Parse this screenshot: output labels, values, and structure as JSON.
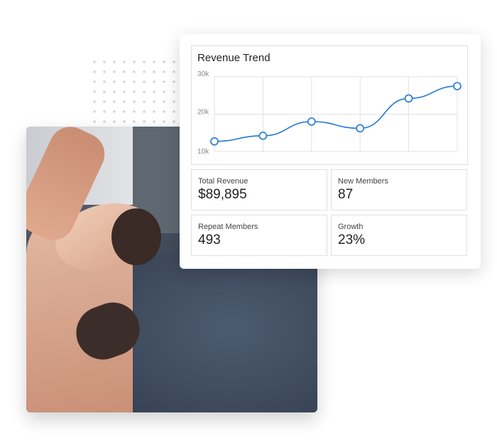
{
  "dashboard": {
    "stats": [
      {
        "label": "Total Revenue",
        "value": "$89,895"
      },
      {
        "label": "New Members",
        "value": "87"
      },
      {
        "label": "Repeat Members",
        "value": "493"
      },
      {
        "label": "Growth",
        "value": "23%"
      }
    ]
  },
  "chart_data": {
    "type": "line",
    "title": "Revenue Trend",
    "x": [
      1,
      2,
      3,
      4,
      5,
      6
    ],
    "values": [
      12700,
      14200,
      18000,
      16200,
      24200,
      27500
    ],
    "ylim": [
      10000,
      30000
    ],
    "yticks": [
      "10k",
      "20k",
      "30k"
    ],
    "grid": true,
    "line_color": "#1e78d7"
  }
}
